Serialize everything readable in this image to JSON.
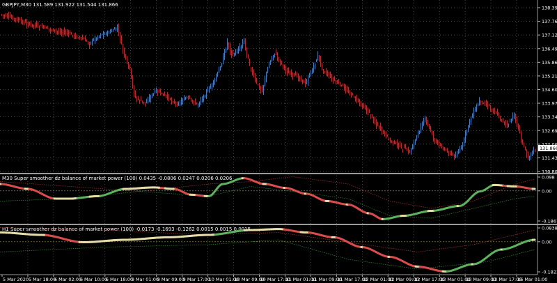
{
  "main": {
    "title": "GBPJPY,M30  131.589 131.922 131.544 131.866",
    "price_labels": [
      "138.395",
      "137.765",
      "137.120",
      "136.490",
      "135.860",
      "135.215",
      "134.600",
      "133.970",
      "133.340",
      "132.695",
      "132.065",
      "131.435",
      "130.805"
    ],
    "current_price": "131.866"
  },
  "sub1": {
    "title": "M30 Super smoother dz balance of market power (100) 0.0435 -0.0806 0.0247 0.0206 0.0206",
    "labels": [
      "0.098",
      "0.00",
      "-0.1867"
    ]
  },
  "sub2": {
    "title": "H1 Super smoother dz balance of market power (100) -0.0173 -0.1693 -0.1262 0.0015 0.0015 0.0015",
    "labels": [
      "0.0838",
      "0.00",
      "-0.1823"
    ]
  },
  "time_labels": [
    "5 Mar 2020",
    "5 Mar 18:00",
    "6 Mar 02:00",
    "6 Mar 10:00",
    "6 Mar 18:00",
    "9 Mar 01:00",
    "9 Mar 09:00",
    "9 Mar 17:00",
    "10 Mar 01:00",
    "10 Mar 09:00",
    "10 Mar 17:00",
    "11 Mar 01:00",
    "11 Mar 09:00",
    "11 Mar 17:00",
    "12 Mar 01:00",
    "12 Mar 09:00",
    "12 Mar 17:00",
    "13 Mar 01:00",
    "13 Mar 09:00",
    "13 Mar 17:00",
    "16 Mar 01:00"
  ],
  "colors": {
    "bull": "#2e7ee8",
    "bear": "#e8161b",
    "grid": "#8a8a8a",
    "osc_up": "#5db35d",
    "osc_dn": "#d94c4c",
    "osc_flat": "#e6dcaa",
    "level_red": "#b03030",
    "level_green": "#2e8b2e",
    "level_gold": "#a89a50",
    "sep": "#9a9a9a",
    "price_box": "#ffffff"
  }
}
